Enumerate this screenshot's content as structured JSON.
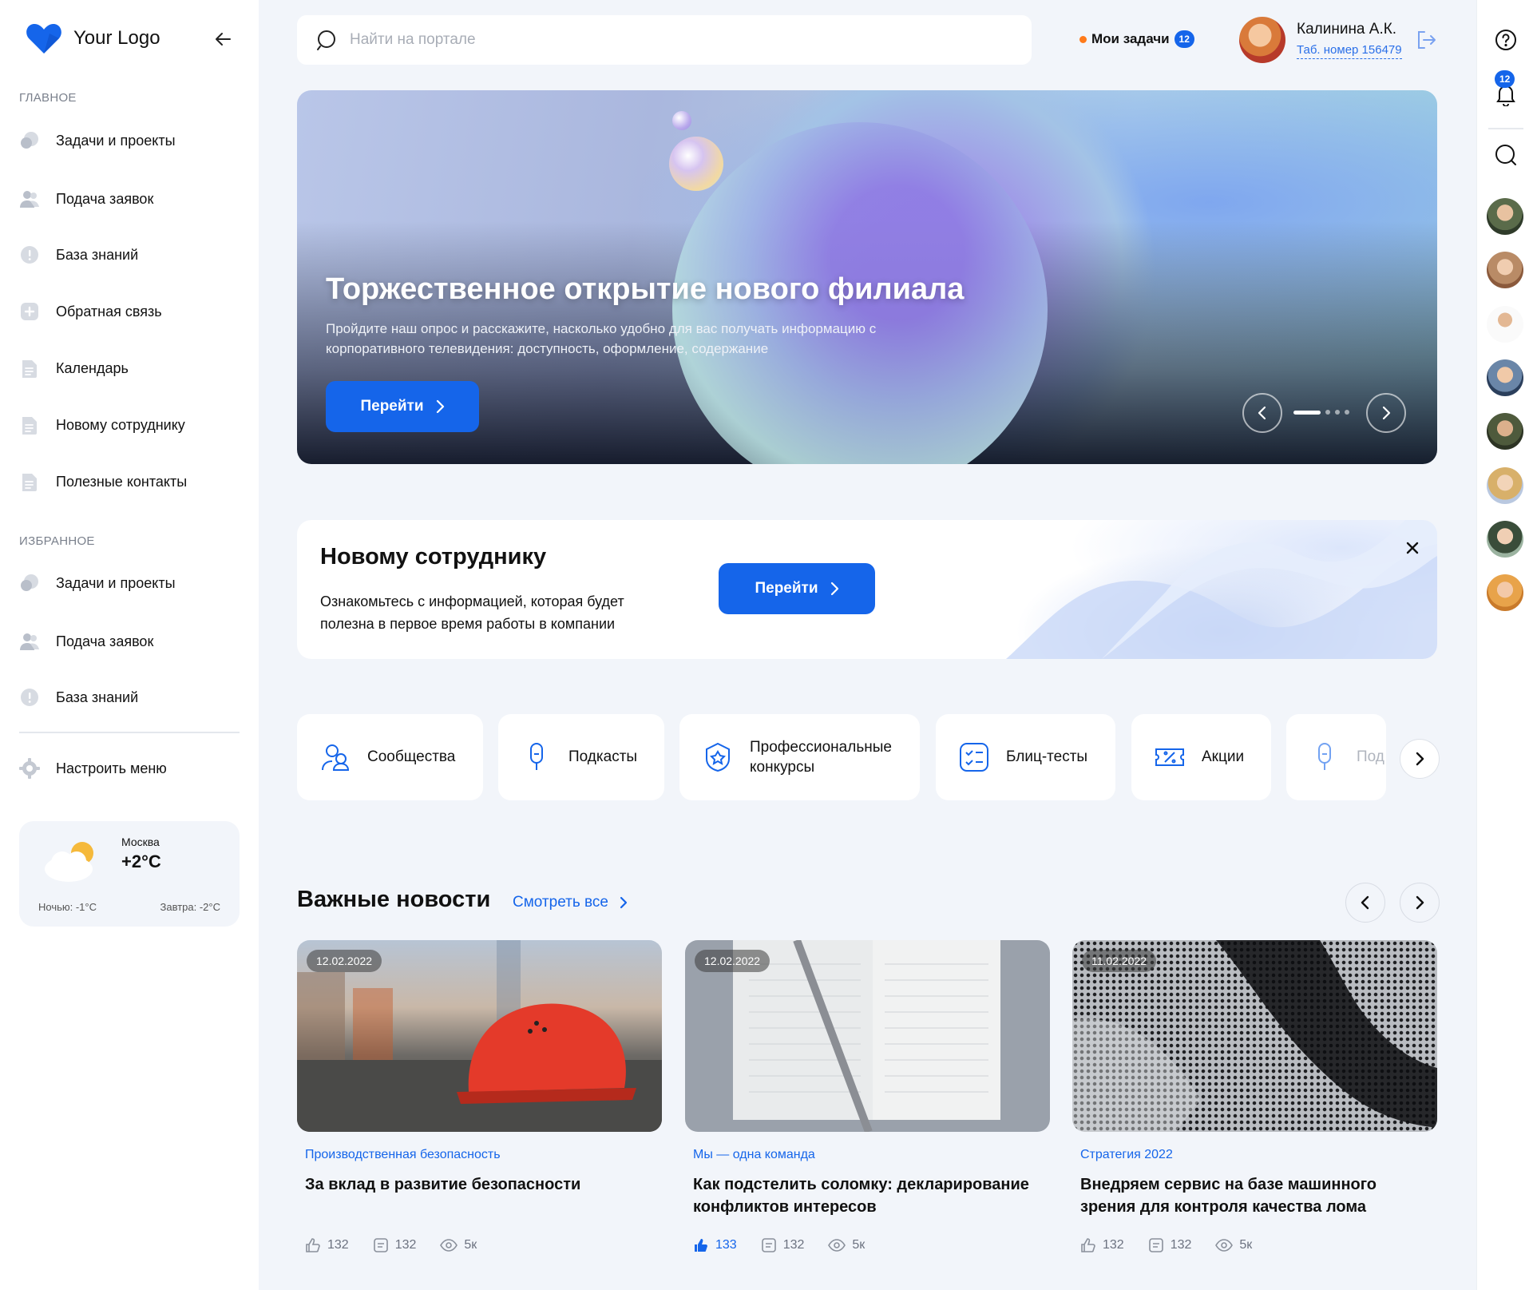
{
  "sidebar": {
    "logo_text": "Your Logo",
    "section_main": "ГЛАВНОЕ",
    "main_items": [
      {
        "label": "Задачи и проекты",
        "icon": "chat-bubbles-icon"
      },
      {
        "label": "Подача заявок",
        "icon": "users-icon"
      },
      {
        "label": "База знаний",
        "icon": "info-circle-icon"
      },
      {
        "label": "Обратная связь",
        "icon": "plus-square-icon"
      },
      {
        "label": "Календарь",
        "icon": "document-icon"
      },
      {
        "label": "Новому сотруднику",
        "icon": "document-icon"
      },
      {
        "label": "Полезные контакты",
        "icon": "document-icon"
      }
    ],
    "section_favorites": "ИЗБРАННОЕ",
    "favorite_items": [
      {
        "label": "Задачи и проекты",
        "icon": "chat-bubbles-icon"
      },
      {
        "label": "Подача заявок",
        "icon": "users-icon"
      },
      {
        "label": "База знаний",
        "icon": "info-circle-icon"
      }
    ],
    "settings_label": "Настроить меню",
    "weather": {
      "city": "Москва",
      "temp": "+2°C",
      "night": "Ночью: -1°C",
      "tomorrow": "Завтра: -2°C"
    }
  },
  "header": {
    "search_placeholder": "Найти на портале",
    "tasks_label": "Мои задачи",
    "tasks_count": "12",
    "user_name": "Калинина А.К.",
    "user_tab": "Таб. номер 156479"
  },
  "hero": {
    "title": "Торжественное открытие нового филиала",
    "subtitle": "Пройдите наш опрос и расскажите, насколько удобно для вас получать информацию с корпоративного телевидения: доступность, оформление, содержание",
    "button": "Перейти",
    "slide_index": 1,
    "slide_count": 4
  },
  "newbie": {
    "title": "Новому сотруднику",
    "text": "Ознакомьтесь с информацией, которая будет полезна в первое время работы в компании",
    "button": "Перейти"
  },
  "categories": [
    {
      "label": "Сообщества",
      "icon": "community-icon"
    },
    {
      "label": "Подкасты",
      "icon": "microphone-icon"
    },
    {
      "label": "Профессиональные конкурсы",
      "icon": "award-shield-icon"
    },
    {
      "label": "Блиц-тесты",
      "icon": "checklist-icon"
    },
    {
      "label": "Акции",
      "icon": "ticket-percent-icon"
    },
    {
      "label": "Под",
      "icon": "microphone-icon"
    }
  ],
  "news": {
    "title": "Важные новости",
    "see_all": "Смотреть все",
    "items": [
      {
        "date": "12.02.2022",
        "category": "Производственная безопасность",
        "title": "За вклад в развитие безопасности",
        "likes": "132",
        "comments": "132",
        "views": "5к",
        "liked": false
      },
      {
        "date": "12.02.2022",
        "category": "Мы — одна команда",
        "title": "Как подстелить соломку: декларирование конфликтов интересов",
        "likes": "133",
        "comments": "132",
        "views": "5к",
        "liked": true
      },
      {
        "date": "11.02.2022",
        "category": "Стратегия 2022",
        "title": "Внедряем сервис на базе машинного зрения для контроля качества лома",
        "likes": "132",
        "comments": "132",
        "views": "5к",
        "liked": false
      }
    ]
  },
  "rightbar": {
    "notifications_count": "12"
  },
  "colors": {
    "accent": "#1565ea",
    "background": "#f2f5fa",
    "tasks_dot": "#ff7a1a"
  }
}
